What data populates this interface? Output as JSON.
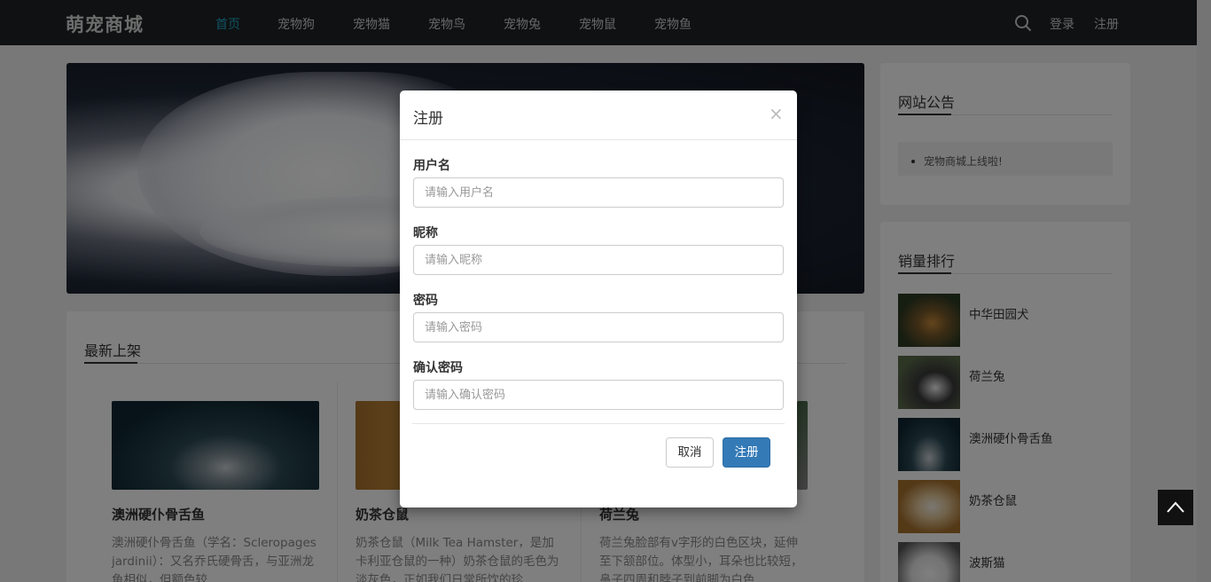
{
  "nav": {
    "brand": "萌宠商城",
    "links": [
      "首页",
      "宠物狗",
      "宠物猫",
      "宠物鸟",
      "宠物兔",
      "宠物鼠",
      "宠物鱼"
    ],
    "login": "登录",
    "register": "注册"
  },
  "latest": {
    "title": "最新上架",
    "items": [
      {
        "name": "澳洲硬仆骨舌鱼",
        "desc": "澳洲硬仆骨舌鱼（学名：Scleropages jardinii）：又名乔氏硬骨舌，与亚洲龙鱼相似，但额色较"
      },
      {
        "name": "奶茶仓鼠",
        "desc": "奶茶仓鼠（Milk Tea Hamster，是加卡利亚仓鼠的一种）奶茶仓鼠的毛色为淡灰色，正如我们日常所饮的珍"
      },
      {
        "name": "荷兰兔",
        "desc": "荷兰兔脸部有v字形的白色区块，延伸至下颔部位。体型小，耳朵也比较短，鼻子四周和脖子到前脚为白色"
      }
    ]
  },
  "notice": {
    "title": "网站公告",
    "items": [
      "宠物商城上线啦!"
    ]
  },
  "ranking": {
    "title": "销量排行",
    "items": [
      "中华田园犬",
      "荷兰兔",
      "澳洲硬仆骨舌鱼",
      "奶茶仓鼠",
      "波斯猫"
    ]
  },
  "modal": {
    "title": "注册",
    "close": "×",
    "fields": [
      {
        "label": "用户名",
        "placeholder": "请输入用户名"
      },
      {
        "label": "昵称",
        "placeholder": "请输入昵称"
      },
      {
        "label": "密码",
        "placeholder": "请输入密码"
      },
      {
        "label": "确认密码",
        "placeholder": "请输入确认密码"
      }
    ],
    "cancel": "取消",
    "submit": "注册"
  }
}
